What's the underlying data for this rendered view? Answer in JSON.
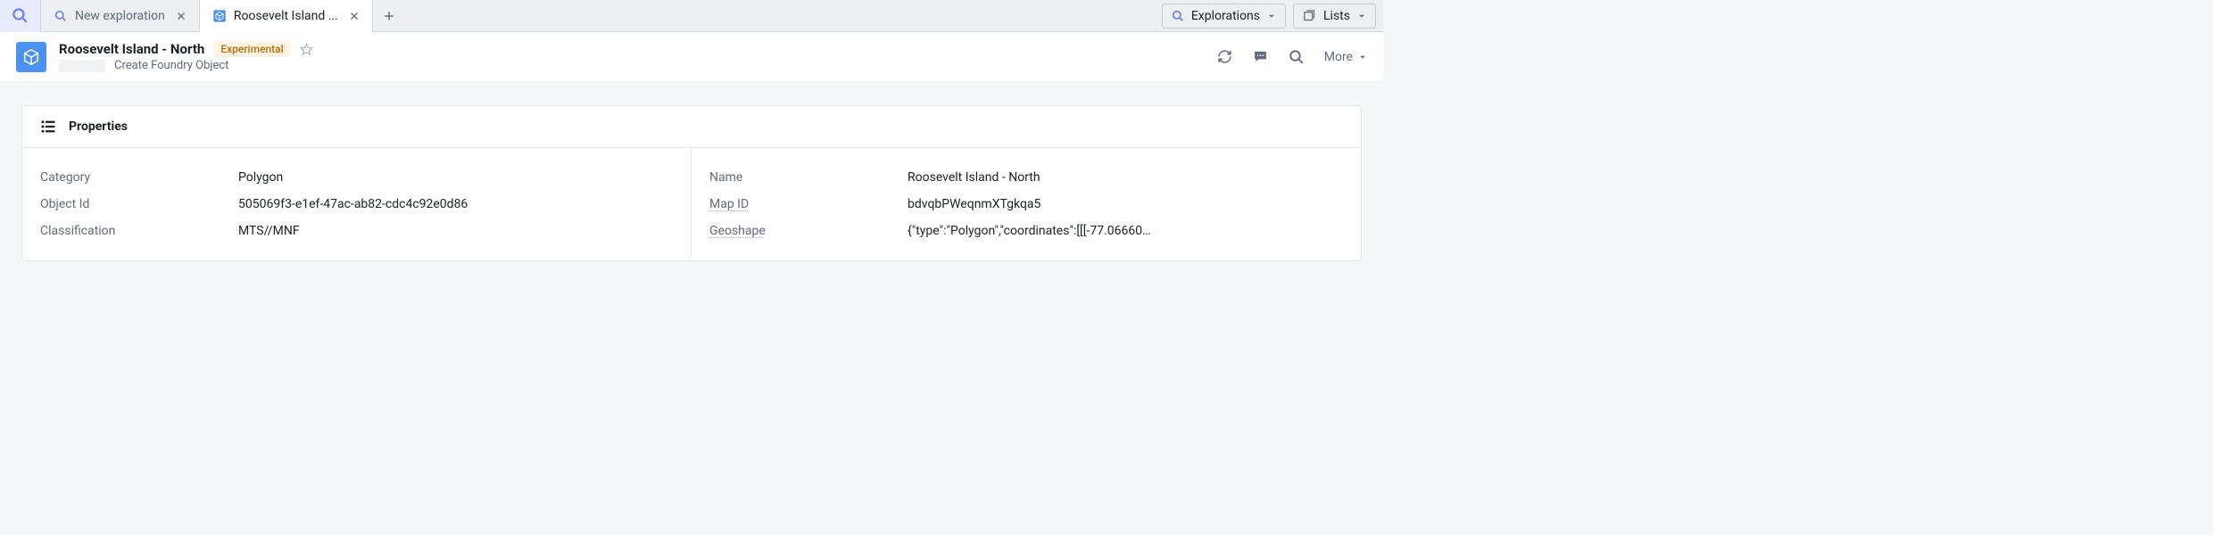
{
  "tabs": {
    "items": [
      {
        "label": "New exploration",
        "active": false
      },
      {
        "label": "Roosevelt Island ...",
        "active": true
      }
    ],
    "explorations_label": "Explorations",
    "lists_label": "Lists"
  },
  "header": {
    "title": "Roosevelt Island - North",
    "badge": "Experimental",
    "subtitle": "Create Foundry Object",
    "more_label": "More"
  },
  "panel": {
    "title": "Properties",
    "left": [
      {
        "label": "Category",
        "value": "Polygon",
        "dotted": false
      },
      {
        "label": "Object Id",
        "value": "505069f3-e1ef-47ac-ab82-cdc4c92e0d86",
        "dotted": false
      },
      {
        "label": "Classification",
        "value": "MTS//MNF",
        "dotted": false
      }
    ],
    "right": [
      {
        "label": "Name",
        "value": "Roosevelt Island - North",
        "dotted": false
      },
      {
        "label": "Map ID",
        "value": "bdvqbPWeqnmXTgkqa5",
        "dotted": true
      },
      {
        "label": "Geoshape",
        "value": "{\"type\":\"Polygon\",\"coordinates\":[[[-77.06660…",
        "dotted": true
      }
    ]
  }
}
